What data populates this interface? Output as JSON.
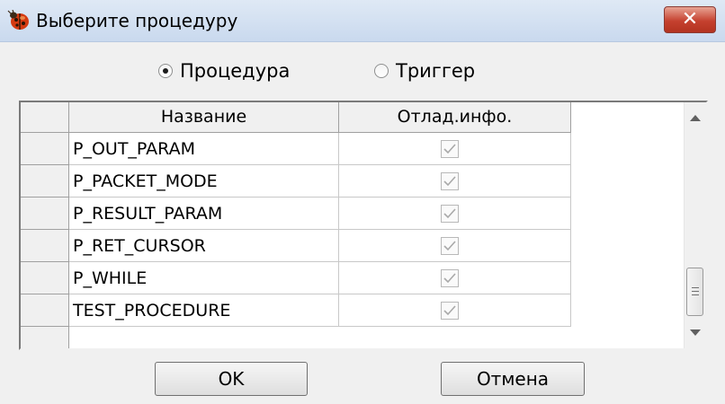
{
  "window": {
    "title": "Выберите процедуру",
    "close_label": "✕"
  },
  "mode": {
    "options": [
      {
        "label": "Процедура",
        "selected": true
      },
      {
        "label": "Триггер",
        "selected": false
      }
    ]
  },
  "table": {
    "columns": [
      "Название",
      "Отлад.инфо."
    ],
    "rows": [
      {
        "name": "P_OUT_PARAM",
        "debug_info": true
      },
      {
        "name": "P_PACKET_MODE",
        "debug_info": true
      },
      {
        "name": "P_RESULT_PARAM",
        "debug_info": true
      },
      {
        "name": "P_RET_CURSOR",
        "debug_info": true
      },
      {
        "name": "P_WHILE",
        "debug_info": true
      },
      {
        "name": "TEST_PROCEDURE",
        "debug_info": true
      }
    ]
  },
  "buttons": {
    "ok_label": "OK",
    "cancel_label": "Отмена"
  },
  "icons": {
    "app": "ladybug-icon",
    "close": "close-icon",
    "scroll_up": "arrow-up-icon",
    "scroll_down": "arrow-down-icon",
    "checkbox": "checkmark-icon"
  },
  "colors": {
    "title_gradient_top": "#dfe9f5",
    "close_button": "#c5412f",
    "dialog_bg": "#f0f0f0"
  }
}
